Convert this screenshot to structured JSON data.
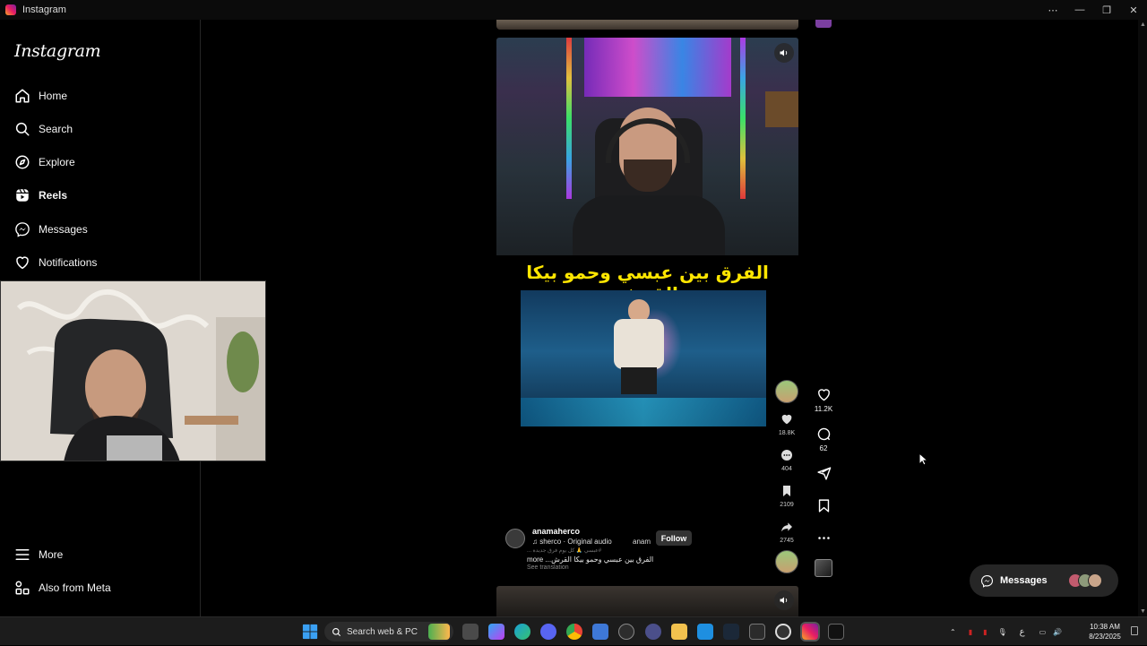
{
  "window": {
    "title": "Instagram"
  },
  "sidebar": {
    "logo": "Instagram",
    "items": [
      {
        "label": "Home",
        "icon": "home-icon"
      },
      {
        "label": "Search",
        "icon": "search-icon"
      },
      {
        "label": "Explore",
        "icon": "compass-icon"
      },
      {
        "label": "Reels",
        "icon": "reels-icon",
        "active": true
      },
      {
        "label": "Messages",
        "icon": "messenger-icon"
      },
      {
        "label": "Notifications",
        "icon": "heart-icon"
      }
    ],
    "bottom": [
      {
        "label": "More",
        "icon": "menu-icon"
      },
      {
        "label": "Also from Meta",
        "icon": "meta-icon"
      }
    ]
  },
  "reel": {
    "caption_overlay": "الفرق بين عبسي وحمو بيكا القرش",
    "inner_counts": {
      "likes": "18.8K",
      "comments": "404",
      "saves": "2109",
      "shares": "2745"
    },
    "author": {
      "username": "anamaherco",
      "audio": "sherco · Original audio",
      "username_short": "anam",
      "follow_label": "Follow"
    },
    "caption_faint": "#عبسي 🙏 كل يوم فرق جديدة ...",
    "caption": "الفرق بين عبسي وحمو بيكا القرش... more",
    "see_translation": "See translation"
  },
  "actions": {
    "likes": "11.2K",
    "comments": "62"
  },
  "messages_pill": {
    "label": "Messages"
  },
  "taskbar": {
    "search_placeholder": "Search web & PC",
    "time": "10:38 AM",
    "date": "8/23/2025",
    "lang": "ع"
  },
  "colors": {
    "background": "#000000",
    "caption_yellow": "#ffe600",
    "sidebar_border": "#262626",
    "pill": "#262626"
  }
}
